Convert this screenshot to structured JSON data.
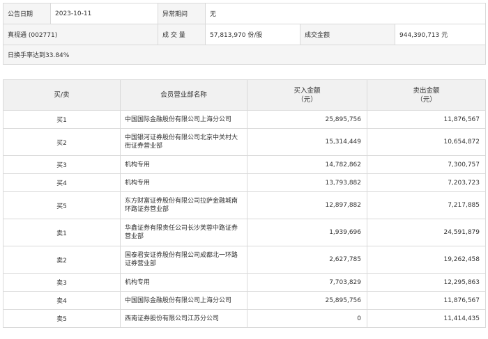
{
  "info": {
    "date_label": "公告日期",
    "date_value": "2023-10-11",
    "period_label": "异常期间",
    "period_value": "无",
    "stock": "真视通 (002771)",
    "volume_label": "成 交 量",
    "volume_value": "57,813,970 份/股",
    "amount_label": "成交金额",
    "amount_value": "944,390,713 元",
    "reason": "日换手率达到33.84%"
  },
  "table": {
    "headers": {
      "side": "买/卖",
      "dept": "会员营业部名称",
      "buy_line1": "买入金额",
      "buy_line2": "（元）",
      "sell_line1": "卖出金额",
      "sell_line2": "（元）"
    },
    "rows": [
      {
        "side": "买1",
        "dept": "中国国际金融股份有限公司上海分公司",
        "buy": "25,895,756",
        "sell": "11,876,567"
      },
      {
        "side": "买2",
        "dept": "中国银河证券股份有限公司北京中关村大街证券营业部",
        "buy": "15,314,449",
        "sell": "10,654,872"
      },
      {
        "side": "买3",
        "dept": "机构专用",
        "buy": "14,782,862",
        "sell": "7,300,757"
      },
      {
        "side": "买4",
        "dept": "机构专用",
        "buy": "13,793,882",
        "sell": "7,203,723"
      },
      {
        "side": "买5",
        "dept": "东方财富证券股份有限公司拉萨金融城南环路证券营业部",
        "buy": "12,897,882",
        "sell": "7,217,885"
      },
      {
        "side": "卖1",
        "dept": "华鑫证券有限责任公司长沙芙蓉中路证券营业部",
        "buy": "1,939,696",
        "sell": "24,591,879"
      },
      {
        "side": "卖2",
        "dept": "国泰君安证券股份有限公司成都北一环路证券营业部",
        "buy": "2,627,785",
        "sell": "19,262,458"
      },
      {
        "side": "卖3",
        "dept": "机构专用",
        "buy": "7,703,829",
        "sell": "12,295,863"
      },
      {
        "side": "卖4",
        "dept": "中国国际金融股份有限公司上海分公司",
        "buy": "25,895,756",
        "sell": "11,876,567"
      },
      {
        "side": "卖5",
        "dept": "西南证券股份有限公司江苏分公司",
        "buy": "0",
        "sell": "11,414,435"
      }
    ]
  }
}
